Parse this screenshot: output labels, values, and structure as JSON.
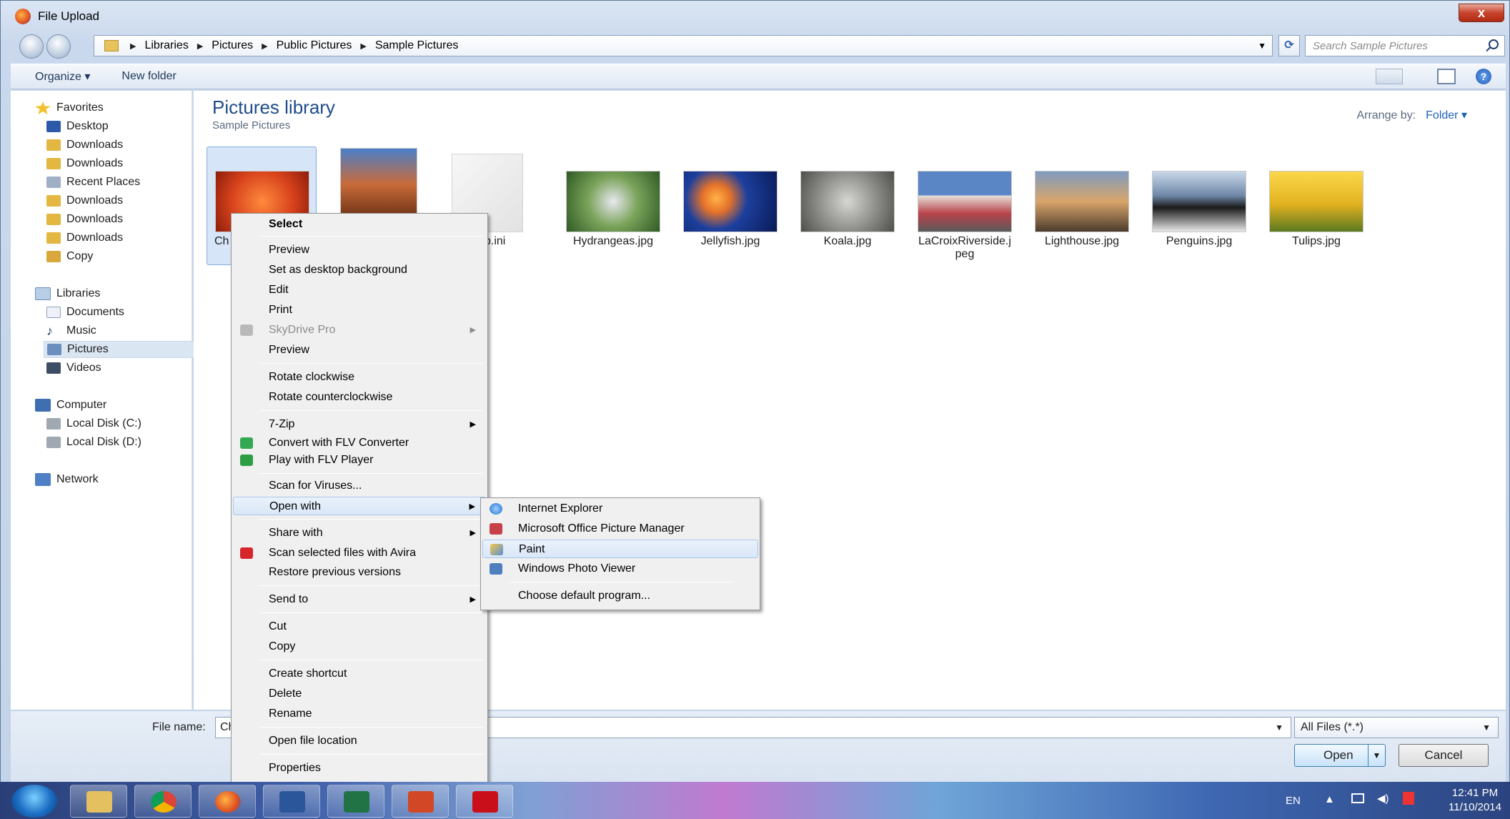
{
  "window": {
    "title": "File Upload",
    "close_label": "x"
  },
  "address": {
    "crumbs": [
      "Libraries",
      "Pictures",
      "Public Pictures",
      "Sample Pictures"
    ],
    "search_placeholder": "Search Sample Pictures"
  },
  "toolbar": {
    "organize": "Organize",
    "new_folder": "New folder"
  },
  "nav": {
    "favorites": "Favorites",
    "fav_items": [
      "Desktop",
      "Downloads",
      "Downloads",
      "Recent Places",
      "Downloads",
      "Downloads",
      "Downloads",
      "Copy"
    ],
    "libraries": "Libraries",
    "lib_items": [
      "Documents",
      "Music",
      "Pictures",
      "Videos"
    ],
    "computer": "Computer",
    "comp_items": [
      "Local Disk (C:)",
      "Local Disk (D:)"
    ],
    "network": "Network"
  },
  "content": {
    "title": "Pictures library",
    "subtitle": "Sample Pictures",
    "arrange_label": "Arrange by:",
    "arrange_value": "Folder",
    "files": [
      {
        "name": "Ch",
        "color": "#d8431c"
      },
      {
        "name": "",
        "color": "#b9542a"
      },
      {
        "name": "ktop.ini",
        "color": "#ededed"
      },
      {
        "name": "Hydrangeas.jpg",
        "color": "#4f8a3a"
      },
      {
        "name": "Jellyfish.jpg",
        "color": "#1c3f9e"
      },
      {
        "name": "Koala.jpg",
        "color": "#8a8a86"
      },
      {
        "name": "LaCroixRiverside.j",
        "name2": "peg",
        "color": "#6b7d99"
      },
      {
        "name": "Lighthouse.jpg",
        "color": "#7a6a5a"
      },
      {
        "name": "Penguins.jpg",
        "color": "#6f88a8"
      },
      {
        "name": "Tulips.jpg",
        "color": "#e1b120"
      }
    ]
  },
  "bottom": {
    "file_name_label": "File name:",
    "file_name_value": "Ch",
    "filter": "All Files (*.*)",
    "open": "Open",
    "cancel": "Cancel"
  },
  "context_menu": {
    "items": [
      "Select",
      "Preview",
      "Set as desktop background",
      "Edit",
      "Print",
      "SkyDrive Pro",
      "Preview",
      "Rotate clockwise",
      "Rotate counterclockwise",
      "7-Zip",
      "Convert with FLV Converter",
      "Play with FLV Player",
      "Scan for Viruses...",
      "Open with",
      "Share with",
      "Scan selected files with Avira",
      "Restore previous versions",
      "Send to",
      "Cut",
      "Copy",
      "Create shortcut",
      "Delete",
      "Rename",
      "Open file location",
      "Properties"
    ]
  },
  "submenu": {
    "items": [
      "Internet Explorer",
      "Microsoft Office Picture Manager",
      "Paint",
      "Windows Photo Viewer",
      "Choose default program..."
    ]
  },
  "taskbar": {
    "lang": "EN",
    "time": "12:41 PM",
    "date": "11/10/2014"
  },
  "colors": {
    "accent": "#1e4b8a",
    "highlight": "#d9e7f7"
  }
}
